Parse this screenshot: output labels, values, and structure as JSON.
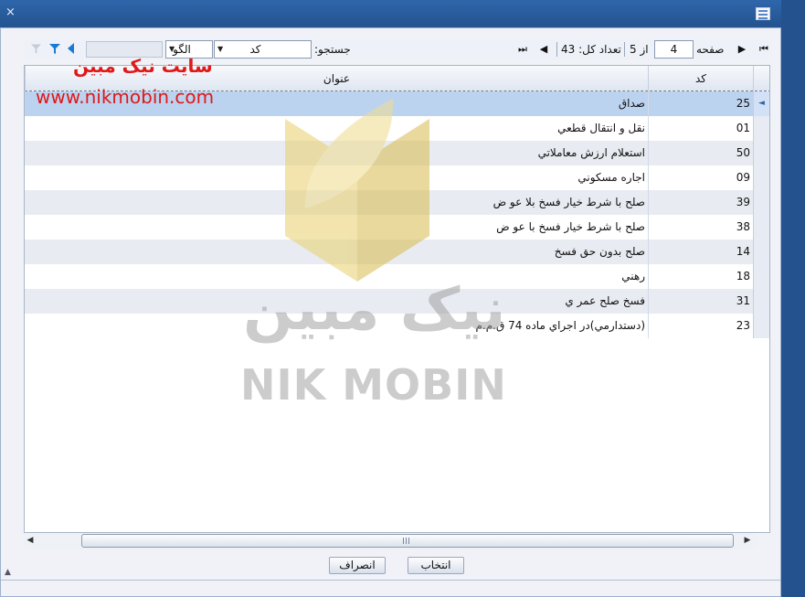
{
  "window": {
    "close_glyph": "×",
    "icon": "window-list-icon"
  },
  "toolbar": {
    "first_glyph": "⏮",
    "next_glyph": "▶",
    "page_label": "صفحه",
    "page_value": "4",
    "of_label": "از 5",
    "prev_glyph": "◀",
    "last_glyph": "⏭",
    "total_label": "تعداد کل: 43",
    "search_label": "جستجو:",
    "search_field_value": "کد",
    "pattern_value": "الگو",
    "filter_icon": "filter-icon",
    "nav_icon": "triangle-left-icon"
  },
  "grid": {
    "columns": {
      "code": "کد",
      "title": "عنوان"
    },
    "rows": [
      {
        "code": "25",
        "title": "صداق"
      },
      {
        "code": "01",
        "title": "نقل و انتقال قطعي"
      },
      {
        "code": "50",
        "title": "استعلام ارزش معاملاتي"
      },
      {
        "code": "09",
        "title": "اجاره مسكوني"
      },
      {
        "code": "39",
        "title": "صلح با شرط خيار فسخ بلا عو ض"
      },
      {
        "code": "38",
        "title": "صلح با شرط خيار فسخ با عو ض"
      },
      {
        "code": "14",
        "title": "صلح بدون حق فسخ"
      },
      {
        "code": "18",
        "title": "رهني"
      },
      {
        "code": "31",
        "title": "فسخ صلح عمر ي"
      },
      {
        "code": "23",
        "title": "(دستدارمي)در اجراي ماده 74 ق.م.م"
      }
    ]
  },
  "buttons": {
    "select": "انتخاب",
    "cancel": "انصراف"
  },
  "overlay": {
    "site_name": "سایت نیک مبین",
    "site_url": "www.nikmobin.com"
  },
  "watermark": {
    "persian": "نیک مبین",
    "english": "NIK MOBIN"
  },
  "colors": {
    "selected_row": "#bcd3ef",
    "alt_row": "#e8ebf1",
    "overlay_red": "#e01818",
    "titlebar": "#2b5797"
  }
}
